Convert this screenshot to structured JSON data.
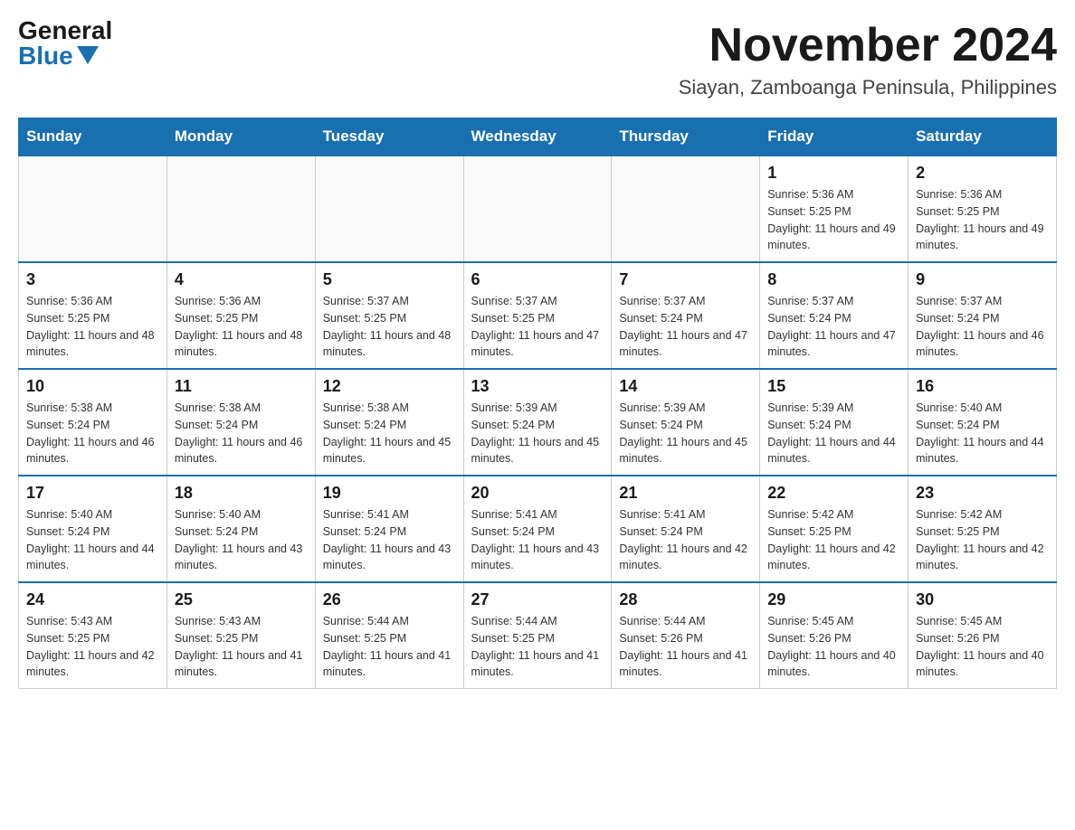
{
  "header": {
    "logo": {
      "general": "General",
      "blue": "Blue"
    },
    "month_title": "November 2024",
    "location": "Siayan, Zamboanga Peninsula, Philippines"
  },
  "weekdays": [
    "Sunday",
    "Monday",
    "Tuesday",
    "Wednesday",
    "Thursday",
    "Friday",
    "Saturday"
  ],
  "weeks": [
    [
      {
        "day": "",
        "info": ""
      },
      {
        "day": "",
        "info": ""
      },
      {
        "day": "",
        "info": ""
      },
      {
        "day": "",
        "info": ""
      },
      {
        "day": "",
        "info": ""
      },
      {
        "day": "1",
        "info": "Sunrise: 5:36 AM\nSunset: 5:25 PM\nDaylight: 11 hours and 49 minutes."
      },
      {
        "day": "2",
        "info": "Sunrise: 5:36 AM\nSunset: 5:25 PM\nDaylight: 11 hours and 49 minutes."
      }
    ],
    [
      {
        "day": "3",
        "info": "Sunrise: 5:36 AM\nSunset: 5:25 PM\nDaylight: 11 hours and 48 minutes."
      },
      {
        "day": "4",
        "info": "Sunrise: 5:36 AM\nSunset: 5:25 PM\nDaylight: 11 hours and 48 minutes."
      },
      {
        "day": "5",
        "info": "Sunrise: 5:37 AM\nSunset: 5:25 PM\nDaylight: 11 hours and 48 minutes."
      },
      {
        "day": "6",
        "info": "Sunrise: 5:37 AM\nSunset: 5:25 PM\nDaylight: 11 hours and 47 minutes."
      },
      {
        "day": "7",
        "info": "Sunrise: 5:37 AM\nSunset: 5:24 PM\nDaylight: 11 hours and 47 minutes."
      },
      {
        "day": "8",
        "info": "Sunrise: 5:37 AM\nSunset: 5:24 PM\nDaylight: 11 hours and 47 minutes."
      },
      {
        "day": "9",
        "info": "Sunrise: 5:37 AM\nSunset: 5:24 PM\nDaylight: 11 hours and 46 minutes."
      }
    ],
    [
      {
        "day": "10",
        "info": "Sunrise: 5:38 AM\nSunset: 5:24 PM\nDaylight: 11 hours and 46 minutes."
      },
      {
        "day": "11",
        "info": "Sunrise: 5:38 AM\nSunset: 5:24 PM\nDaylight: 11 hours and 46 minutes."
      },
      {
        "day": "12",
        "info": "Sunrise: 5:38 AM\nSunset: 5:24 PM\nDaylight: 11 hours and 45 minutes."
      },
      {
        "day": "13",
        "info": "Sunrise: 5:39 AM\nSunset: 5:24 PM\nDaylight: 11 hours and 45 minutes."
      },
      {
        "day": "14",
        "info": "Sunrise: 5:39 AM\nSunset: 5:24 PM\nDaylight: 11 hours and 45 minutes."
      },
      {
        "day": "15",
        "info": "Sunrise: 5:39 AM\nSunset: 5:24 PM\nDaylight: 11 hours and 44 minutes."
      },
      {
        "day": "16",
        "info": "Sunrise: 5:40 AM\nSunset: 5:24 PM\nDaylight: 11 hours and 44 minutes."
      }
    ],
    [
      {
        "day": "17",
        "info": "Sunrise: 5:40 AM\nSunset: 5:24 PM\nDaylight: 11 hours and 44 minutes."
      },
      {
        "day": "18",
        "info": "Sunrise: 5:40 AM\nSunset: 5:24 PM\nDaylight: 11 hours and 43 minutes."
      },
      {
        "day": "19",
        "info": "Sunrise: 5:41 AM\nSunset: 5:24 PM\nDaylight: 11 hours and 43 minutes."
      },
      {
        "day": "20",
        "info": "Sunrise: 5:41 AM\nSunset: 5:24 PM\nDaylight: 11 hours and 43 minutes."
      },
      {
        "day": "21",
        "info": "Sunrise: 5:41 AM\nSunset: 5:24 PM\nDaylight: 11 hours and 42 minutes."
      },
      {
        "day": "22",
        "info": "Sunrise: 5:42 AM\nSunset: 5:25 PM\nDaylight: 11 hours and 42 minutes."
      },
      {
        "day": "23",
        "info": "Sunrise: 5:42 AM\nSunset: 5:25 PM\nDaylight: 11 hours and 42 minutes."
      }
    ],
    [
      {
        "day": "24",
        "info": "Sunrise: 5:43 AM\nSunset: 5:25 PM\nDaylight: 11 hours and 42 minutes."
      },
      {
        "day": "25",
        "info": "Sunrise: 5:43 AM\nSunset: 5:25 PM\nDaylight: 11 hours and 41 minutes."
      },
      {
        "day": "26",
        "info": "Sunrise: 5:44 AM\nSunset: 5:25 PM\nDaylight: 11 hours and 41 minutes."
      },
      {
        "day": "27",
        "info": "Sunrise: 5:44 AM\nSunset: 5:25 PM\nDaylight: 11 hours and 41 minutes."
      },
      {
        "day": "28",
        "info": "Sunrise: 5:44 AM\nSunset: 5:26 PM\nDaylight: 11 hours and 41 minutes."
      },
      {
        "day": "29",
        "info": "Sunrise: 5:45 AM\nSunset: 5:26 PM\nDaylight: 11 hours and 40 minutes."
      },
      {
        "day": "30",
        "info": "Sunrise: 5:45 AM\nSunset: 5:26 PM\nDaylight: 11 hours and 40 minutes."
      }
    ]
  ]
}
